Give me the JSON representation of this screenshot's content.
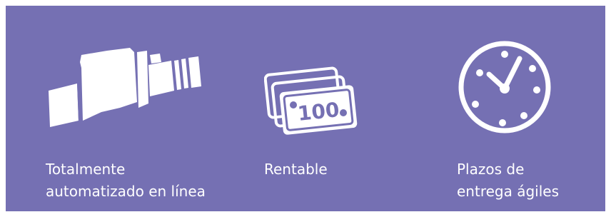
{
  "panel": {
    "background": "#7570b3",
    "foreground": "#ffffff"
  },
  "features": [
    {
      "icon": "production-machine-icon",
      "label_lines": [
        "Totalmente",
        "automatizado en línea"
      ]
    },
    {
      "icon": "banknotes-icon",
      "banknote_value": "100",
      "label_lines": [
        "Rentable"
      ]
    },
    {
      "icon": "clock-icon",
      "label_lines": [
        "Plazos de",
        "entrega ágiles"
      ]
    }
  ]
}
